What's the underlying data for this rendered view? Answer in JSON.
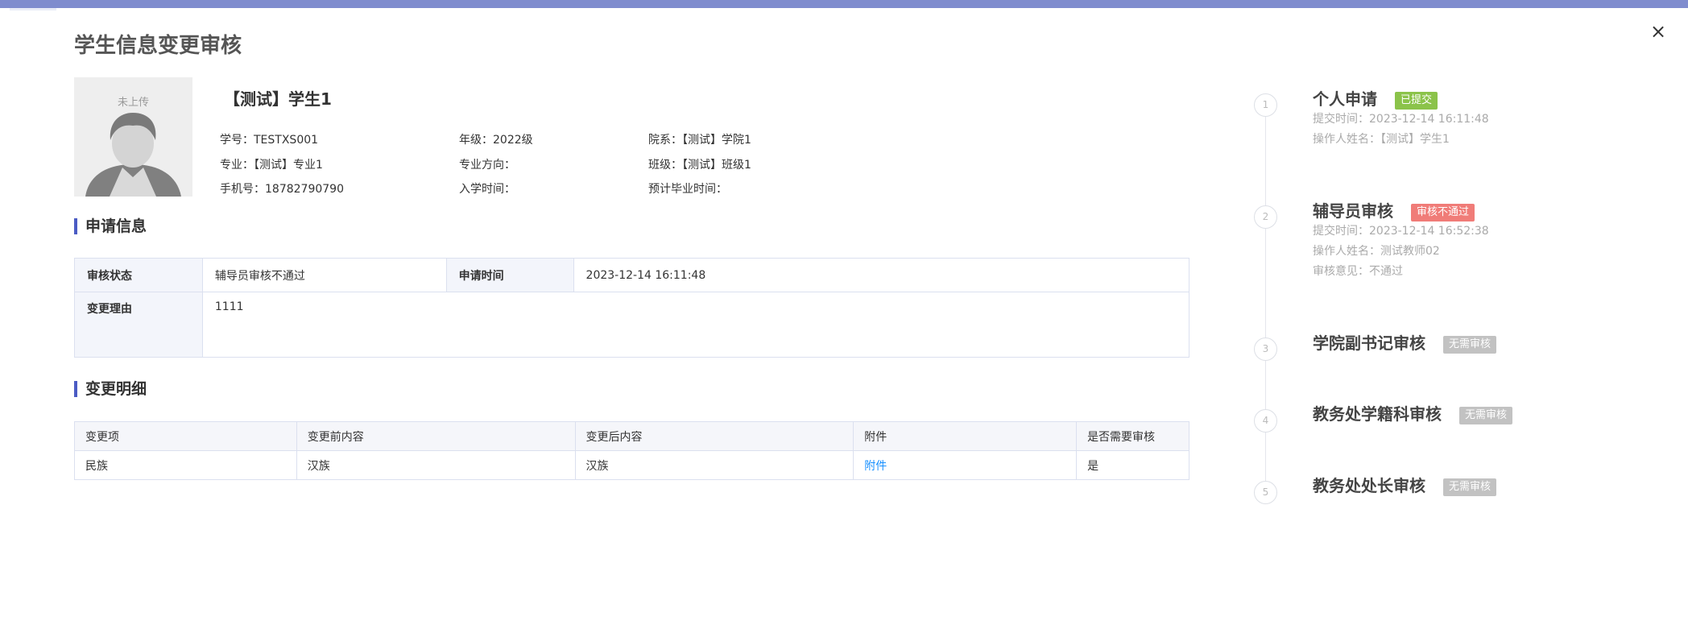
{
  "dialog": {
    "title": "学生信息变更审核",
    "close_symbol": "×"
  },
  "avatar": {
    "placeholder_text": "未上传"
  },
  "student": {
    "name": "【测试】学生1",
    "fields": {
      "student_id": "学号：TESTXS001",
      "grade": "年级：2022级",
      "department": "院系：【测试】学院1",
      "major": "专业：【测试】专业1",
      "major_direction": "专业方向：",
      "class": "班级：【测试】班级1",
      "phone": "手机号：18782790790",
      "enroll_time": "入学时间：",
      "graduation_time": "预计毕业时间："
    }
  },
  "application": {
    "section_title": "申请信息",
    "status_label": "审核状态",
    "status_value": "辅导员审核不通过",
    "time_label": "申请时间",
    "time_value": "2023-12-14 16:11:48",
    "reason_label": "变更理由",
    "reason_value": "1111"
  },
  "changes": {
    "section_title": "变更明细",
    "headers": [
      "变更项",
      "变更前内容",
      "变更后内容",
      "附件",
      "是否需要审核"
    ],
    "rows": [
      [
        "民族",
        "汉族",
        "汉族",
        "附件",
        "是"
      ]
    ]
  },
  "timeline": {
    "steps": [
      {
        "number": "1",
        "title": "个人申请",
        "badge": "已提交",
        "badge_color": "#8bc34a",
        "meta": [
          "提交时间：2023-12-14 16:11:48",
          "操作人姓名：【测试】学生1"
        ]
      },
      {
        "number": "2",
        "title": "辅导员审核",
        "badge": "审核不通过",
        "badge_color": "#f07c78",
        "meta": [
          "提交时间：2023-12-14 16:52:38",
          "操作人姓名：测试教师02",
          "审核意见：不通过"
        ]
      },
      {
        "number": "3",
        "title": "学院副书记审核",
        "badge": "无需审核",
        "badge_color": "#c2c2c2",
        "meta": []
      },
      {
        "number": "4",
        "title": "教务处学籍科审核",
        "badge": "无需审核",
        "badge_color": "#c2c2c2",
        "meta": []
      },
      {
        "number": "5",
        "title": "教务处处长审核",
        "badge": "无需审核",
        "badge_color": "#c2c2c2",
        "meta": []
      }
    ]
  },
  "colors": {
    "accent": "#4b5cc4",
    "header_bar": "#7f8cce",
    "link": "#1890ff"
  }
}
